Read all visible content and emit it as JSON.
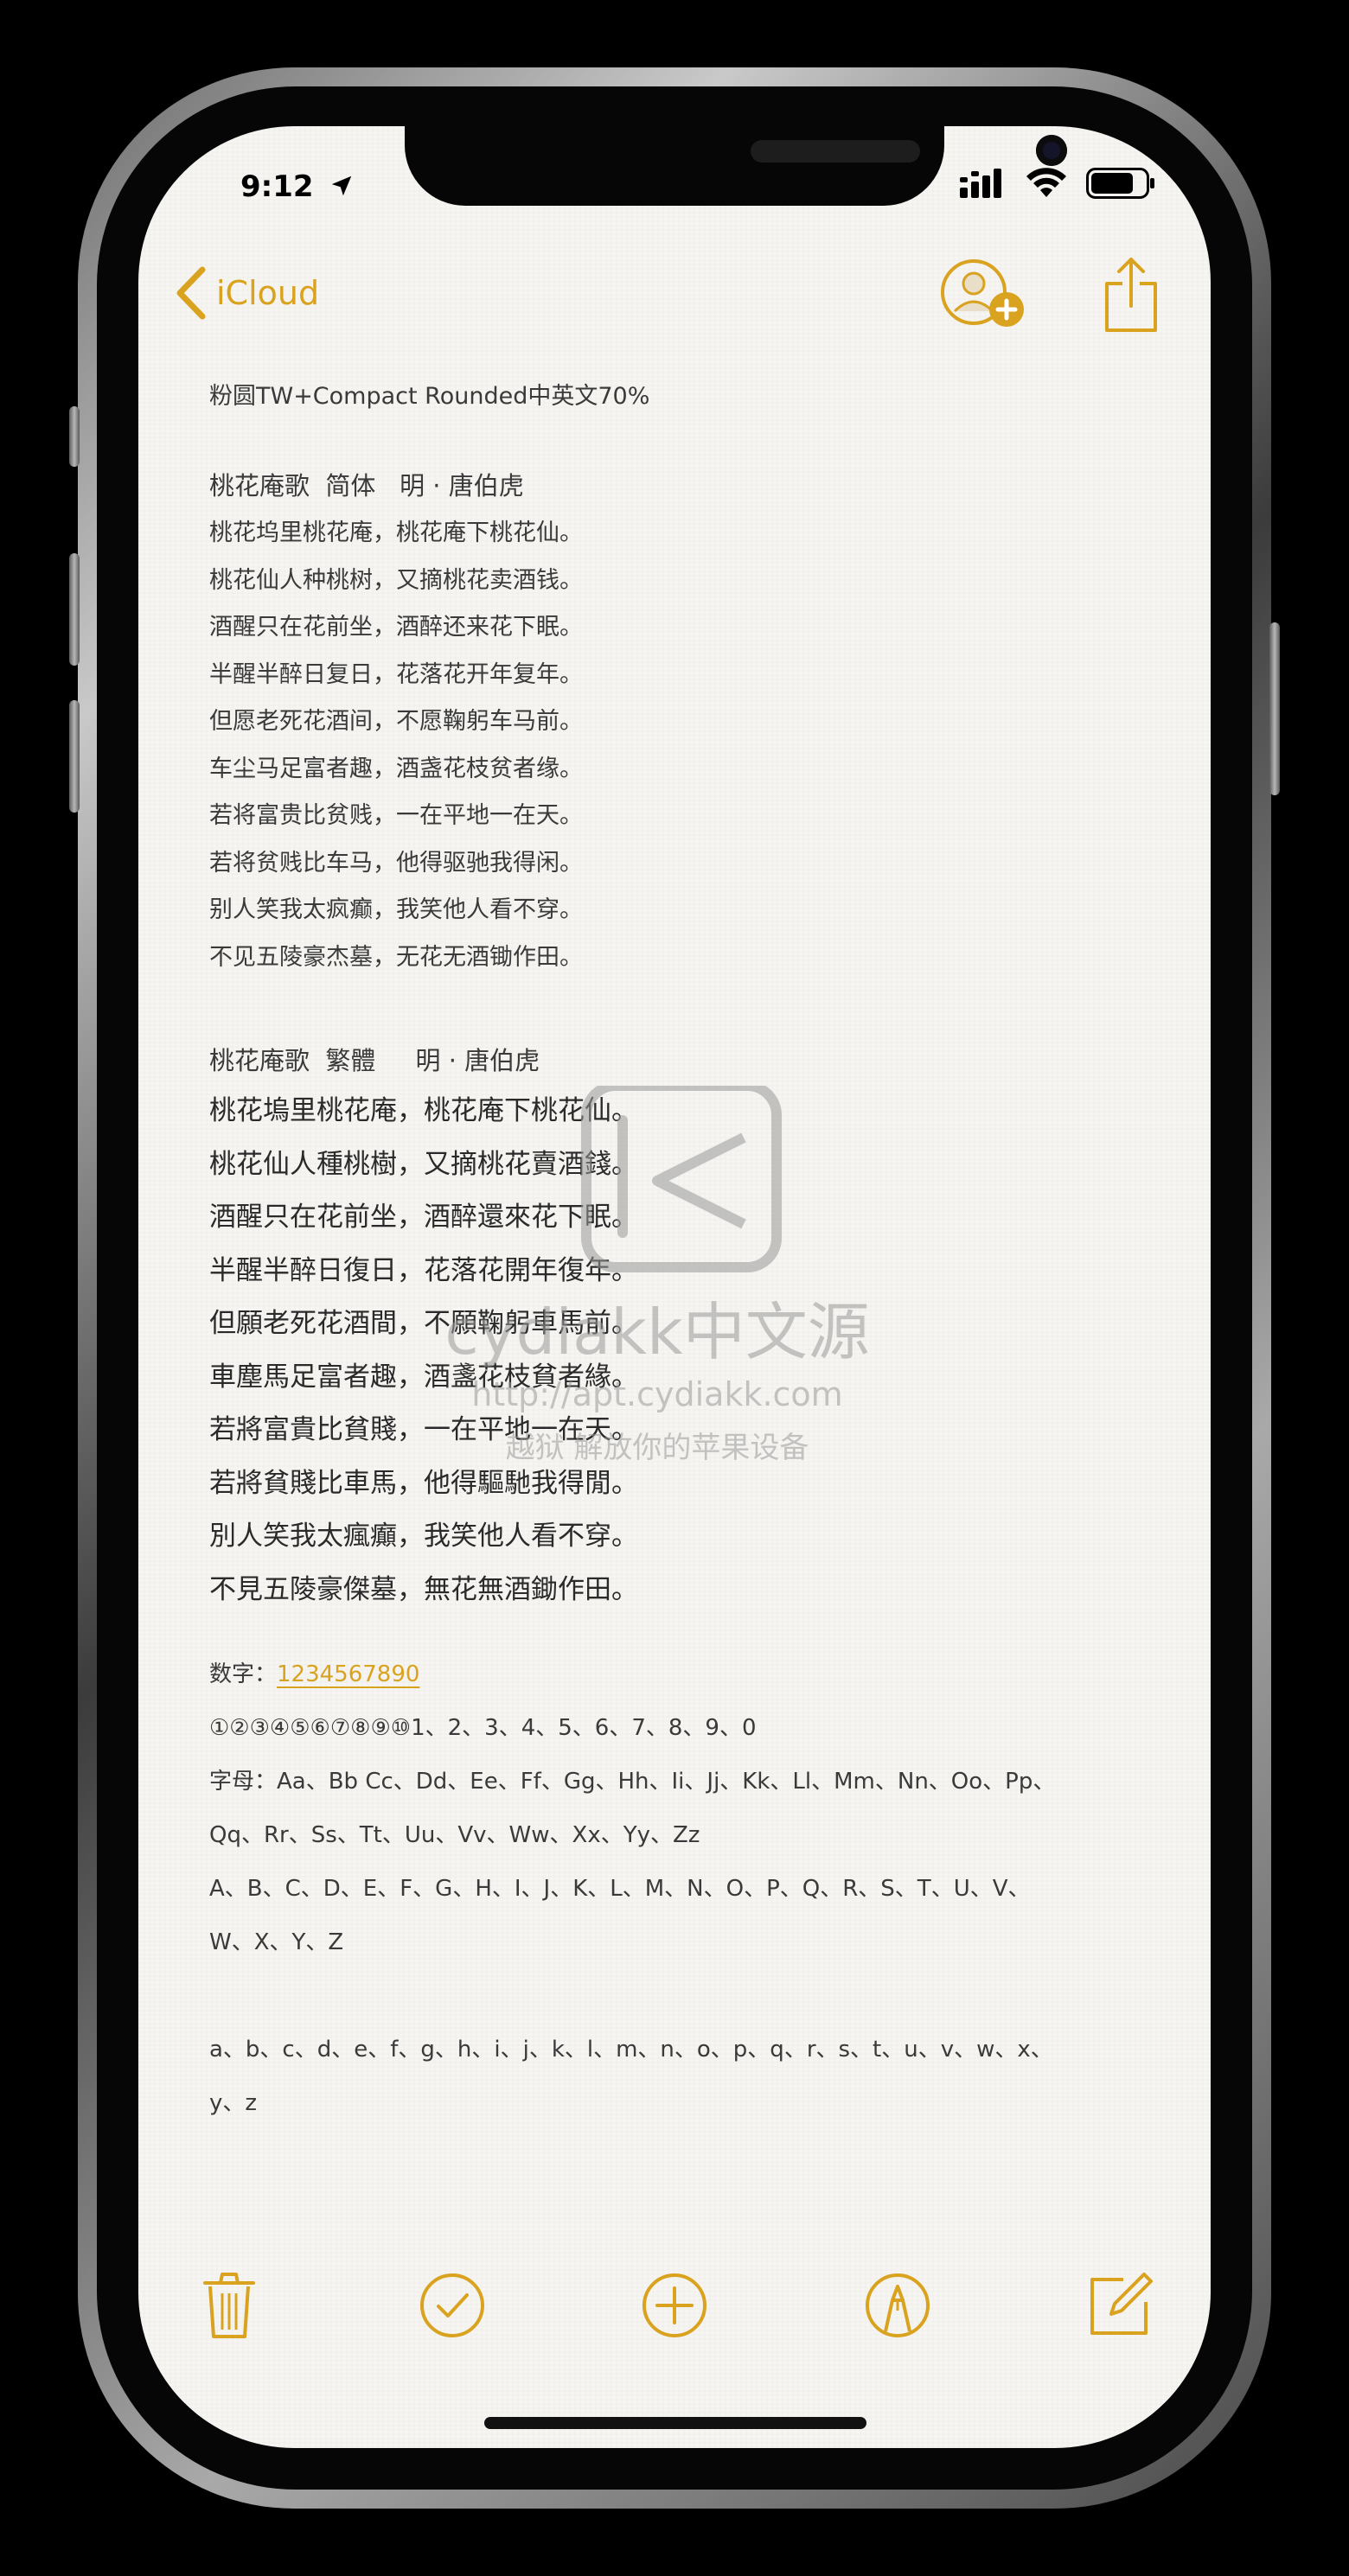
{
  "status_bar": {
    "time": "9:12"
  },
  "nav": {
    "back_label": "iCloud"
  },
  "note": {
    "title": "粉圆TW+Compact Rounded中英文70%",
    "simplified": {
      "heading": "桃花庵歌  简体   明 · 唐伯虎",
      "lines": [
        "桃花坞里桃花庵，桃花庵下桃花仙。",
        "桃花仙人种桃树，又摘桃花卖酒钱。",
        "酒醒只在花前坐，酒醉还来花下眠。",
        "半醒半醉日复日，花落花开年复年。",
        "但愿老死花酒间，不愿鞠躬车马前。",
        "车尘马足富者趣，酒盏花枝贫者缘。",
        "若将富贵比贫贱，一在平地一在天。",
        "若将贫贱比车马，他得驱驰我得闲。",
        "别人笑我太疯癫，我笑他人看不穿。",
        "不见五陵豪杰墓，无花无酒锄作田。"
      ]
    },
    "traditional": {
      "heading": "桃花庵歌  繁體     明 · 唐伯虎",
      "lines": [
        "桃花塢里桃花庵，桃花庵下桃花仙。",
        "桃花仙人種桃樹，又摘桃花賣酒錢。",
        "酒醒只在花前坐，酒醉還來花下眠。",
        "半醒半醉日復日，花落花開年復年。",
        "但願老死花酒間，不願鞠躬車馬前。",
        "車塵馬足富者趣，酒盞花枝貧者緣。",
        "若將富貴比貧賤，一在平地一在天。",
        "若將貧賤比車馬，他得驅馳我得閒。",
        "別人笑我太瘋癲，我笑他人看不穿。",
        "不見五陵豪傑墓，無花無酒鋤作田。"
      ]
    },
    "numbers_label": "数字：",
    "numbers_link": "1234567890",
    "numbers_line": "①②③④⑤⑥⑦⑧⑨⑩1、2、3、4、5、6、7、8、9、0",
    "letters_line1": "字母：Aa、Bb Cc、Dd、Ee、Ff、Gg、Hh、Ii、Jj、Kk、Ll、Mm、Nn、Oo、Pp、",
    "letters_line2": "Qq、Rr、Ss、Tt、Uu、Vv、Ww、Xx、Yy、Zz",
    "upper_line1": "A、B、C、D、E、F、G、H、I、J、K、L、M、N、O、P、Q、R、S、T、U、V、",
    "upper_line2": "W、X、Y、Z",
    "lower_line1": "a、b、c、d、e、f、g、h、i、j、k、l、m、n、o、p、q、r、s、t、u、v、w、x、",
    "lower_line2": "y、z"
  },
  "watermark": {
    "brand": "cydiakk中文源",
    "url": "http://apt.cydiakk.com",
    "slogan": "越狱 解放你的苹果设备"
  },
  "theme": {
    "accent": "#d9a21f",
    "paper": "#f6f5f2",
    "text": "#3a3a3a"
  }
}
